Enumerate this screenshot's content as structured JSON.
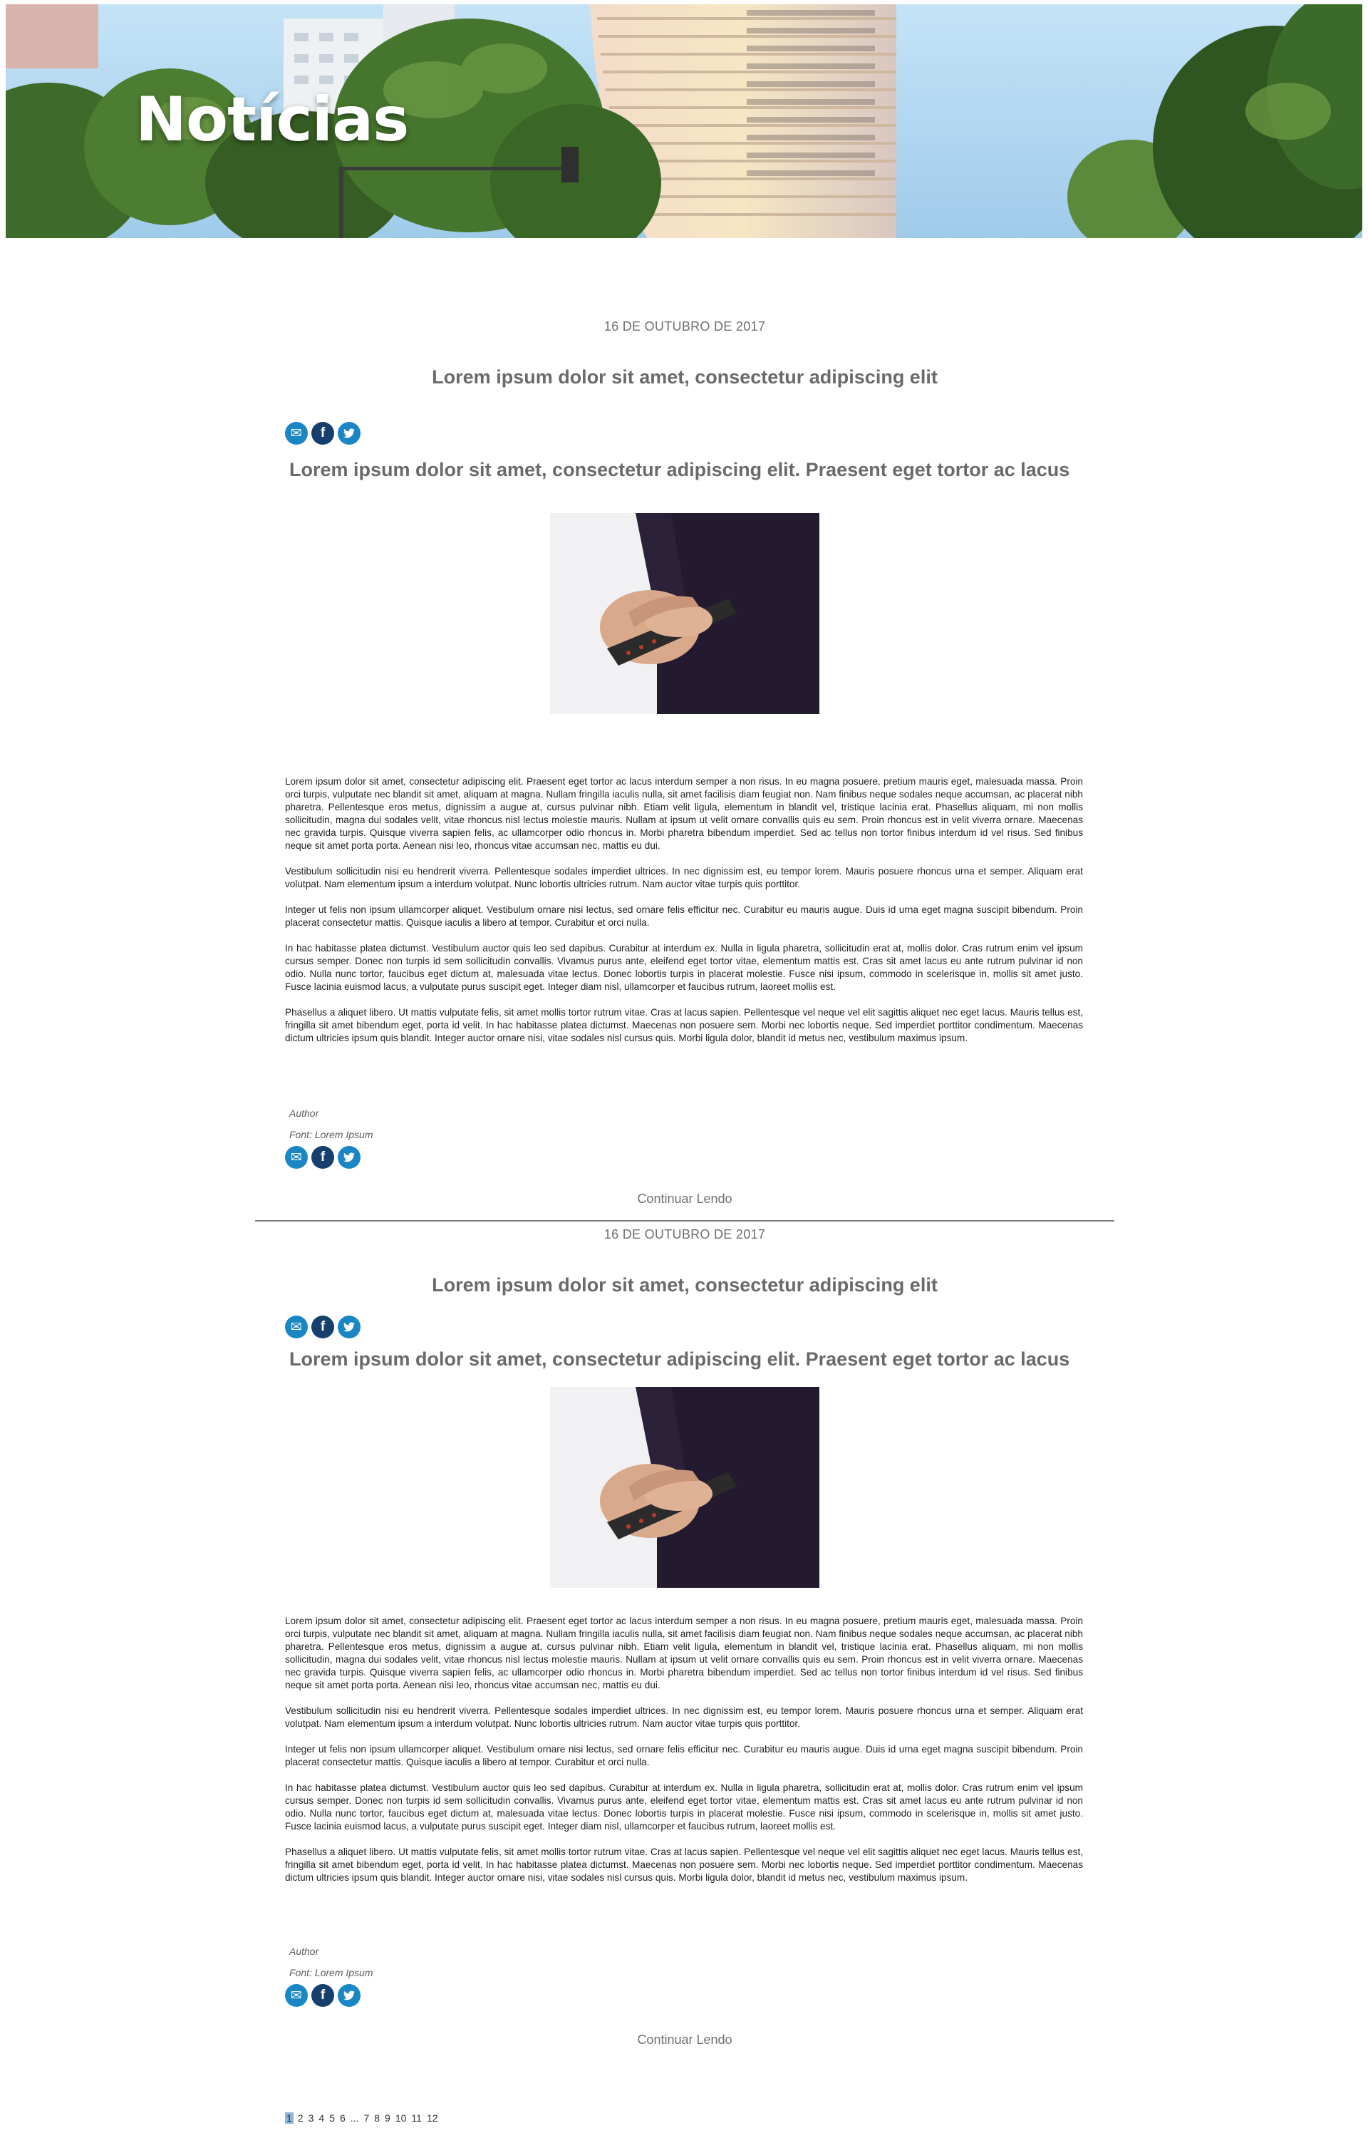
{
  "hero": {
    "title": "Notícias"
  },
  "share": {
    "email_icon": "✉",
    "facebook_icon": "f",
    "twitter_icon": "🐦"
  },
  "posts": [
    {
      "date": "16 DE OUTUBRO DE 2017",
      "title": "Lorem ipsum dolor sit amet, consectetur adipiscing elit",
      "subtitle": "Lorem ipsum dolor sit amet, consectetur adipiscing elit. Praesent eget tortor ac lacus",
      "paragraphs": [
        "Lorem ipsum dolor sit amet, consectetur adipiscing elit. Praesent eget tortor ac lacus interdum semper a non risus. In eu magna posuere, pretium mauris eget, malesuada massa. Proin orci turpis, vulputate nec blandit sit amet, aliquam at magna. Nullam fringilla iaculis nulla, sit amet facilisis diam feugiat non. Nam finibus neque sodales neque accumsan, ac placerat nibh pharetra. Pellentesque eros metus, dignissim a augue at, cursus pulvinar nibh. Etiam velit ligula, elementum in blandit vel, tristique lacinia erat. Phasellus aliquam, mi non mollis sollicitudin, magna dui sodales velit, vitae rhoncus nisl lectus molestie mauris. Nullam at ipsum ut velit ornare convallis quis eu sem. Proin rhoncus est in velit viverra ornare. Maecenas nec gravida turpis. Quisque viverra sapien felis, ac ullamcorper odio rhoncus in. Morbi pharetra bibendum imperdiet. Sed ac tellus non tortor finibus interdum id vel risus. Sed finibus neque sit amet porta porta. Aenean nisi leo, rhoncus vitae accumsan nec, mattis eu dui.",
        "Vestibulum sollicitudin nisi eu hendrerit viverra. Pellentesque sodales imperdiet ultrices. In nec dignissim est, eu tempor lorem. Mauris posuere rhoncus urna et semper. Aliquam erat volutpat. Nam elementum ipsum a interdum volutpat. Nunc lobortis ultricies rutrum. Nam auctor vitae turpis quis porttitor.",
        "Integer ut felis non ipsum ullamcorper aliquet. Vestibulum ornare nisi lectus, sed ornare felis efficitur nec. Curabitur eu mauris augue. Duis id urna eget magna suscipit bibendum. Proin placerat consectetur mattis. Quisque iaculis a libero at tempor. Curabitur et orci nulla.",
        "In hac habitasse platea dictumst. Vestibulum auctor quis leo sed dapibus. Curabitur at interdum ex. Nulla in ligula pharetra, sollicitudin erat at, mollis dolor. Cras rutrum enim vel ipsum cursus semper. Donec non turpis id sem sollicitudin convallis. Vivamus purus ante, eleifend eget tortor vitae, elementum mattis est. Cras sit amet lacus eu ante rutrum pulvinar id non odio. Nulla nunc tortor, faucibus eget dictum at, malesuada vitae lectus. Donec lobortis turpis in placerat molestie. Fusce nisi ipsum, commodo in scelerisque in, mollis sit amet justo. Fusce lacinia euismod lacus, a vulputate purus suscipit eget. Integer diam nisl, ullamcorper et faucibus rutrum, laoreet mollis est.",
        "Phasellus a aliquet libero. Ut mattis vulputate felis, sit amet mollis tortor rutrum vitae. Cras at lacus sapien. Pellentesque vel neque vel elit sagittis aliquet nec eget lacus. Mauris tellus est, fringilla sit amet bibendum eget, porta id velit. In hac habitasse platea dictumst. Maecenas non posuere sem. Morbi nec lobortis neque. Sed imperdiet porttitor condimentum. Maecenas dictum ultricies ipsum quis blandit. Integer auctor ornare nisi, vitae sodales nisl cursus quis. Morbi ligula dolor, blandit id metus nec, vestibulum maximus ipsum."
      ],
      "author": "Author",
      "font": "Font: Lorem Ipsum",
      "continue_label": "Continuar Lendo"
    },
    {
      "date": "16 DE OUTUBRO DE 2017",
      "title": "Lorem ipsum dolor sit amet, consectetur adipiscing elit",
      "subtitle": "Lorem ipsum dolor sit amet, consectetur adipiscing elit. Praesent eget tortor ac lacus",
      "paragraphs": [
        "Lorem ipsum dolor sit amet, consectetur adipiscing elit. Praesent eget tortor ac lacus interdum semper a non risus. In eu magna posuere, pretium mauris eget, malesuada massa. Proin orci turpis, vulputate nec blandit sit amet, aliquam at magna. Nullam fringilla iaculis nulla, sit amet facilisis diam feugiat non. Nam finibus neque sodales neque accumsan, ac placerat nibh pharetra. Pellentesque eros metus, dignissim a augue at, cursus pulvinar nibh. Etiam velit ligula, elementum in blandit vel, tristique lacinia erat. Phasellus aliquam, mi non mollis sollicitudin, magna dui sodales velit, vitae rhoncus nisl lectus molestie mauris. Nullam at ipsum ut velit ornare convallis quis eu sem. Proin rhoncus est in velit viverra ornare. Maecenas nec gravida turpis. Quisque viverra sapien felis, ac ullamcorper odio rhoncus in. Morbi pharetra bibendum imperdiet. Sed ac tellus non tortor finibus interdum id vel risus. Sed finibus neque sit amet porta porta. Aenean nisi leo, rhoncus vitae accumsan nec, mattis eu dui.",
        "Vestibulum sollicitudin nisi eu hendrerit viverra. Pellentesque sodales imperdiet ultrices. In nec dignissim est, eu tempor lorem. Mauris posuere rhoncus urna et semper. Aliquam erat volutpat. Nam elementum ipsum a interdum volutpat. Nunc lobortis ultricies rutrum. Nam auctor vitae turpis quis porttitor.",
        "Integer ut felis non ipsum ullamcorper aliquet. Vestibulum ornare nisi lectus, sed ornare felis efficitur nec. Curabitur eu mauris augue. Duis id urna eget magna suscipit bibendum. Proin placerat consectetur mattis. Quisque iaculis a libero at tempor. Curabitur et orci nulla.",
        "In hac habitasse platea dictumst. Vestibulum auctor quis leo sed dapibus. Curabitur at interdum ex. Nulla in ligula pharetra, sollicitudin erat at, mollis dolor. Cras rutrum enim vel ipsum cursus semper. Donec non turpis id sem sollicitudin convallis. Vivamus purus ante, eleifend eget tortor vitae, elementum mattis est. Cras sit amet lacus eu ante rutrum pulvinar id non odio. Nulla nunc tortor, faucibus eget dictum at, malesuada vitae lectus. Donec lobortis turpis in placerat molestie. Fusce nisi ipsum, commodo in scelerisque in, mollis sit amet justo. Fusce lacinia euismod lacus, a vulputate purus suscipit eget. Integer diam nisl, ullamcorper et faucibus rutrum, laoreet mollis est.",
        "Phasellus a aliquet libero. Ut mattis vulputate felis, sit amet mollis tortor rutrum vitae. Cras at lacus sapien. Pellentesque vel neque vel elit sagittis aliquet nec eget lacus. Mauris tellus est, fringilla sit amet bibendum eget, porta id velit. In hac habitasse platea dictumst. Maecenas non posuere sem. Morbi nec lobortis neque. Sed imperdiet porttitor condimentum. Maecenas dictum ultricies ipsum quis blandit. Integer auctor ornare nisi, vitae sodales nisl cursus quis. Morbi ligula dolor, blandit id metus nec, vestibulum maximus ipsum."
      ],
      "author": "Author",
      "font": "Font: Lorem Ipsum",
      "continue_label": "Continuar Lendo"
    }
  ],
  "pagination": {
    "pages": [
      "1",
      "2",
      "3",
      "4",
      "5",
      "6",
      "...",
      "7",
      "8",
      "9",
      "10",
      "11",
      "12"
    ],
    "current": "1"
  },
  "colors": {
    "share_blue": "#1b86c4",
    "facebook_navy": "#173f6e",
    "text_gray": "#6a6a6a",
    "current_page_bg": "#8fb6d6"
  }
}
